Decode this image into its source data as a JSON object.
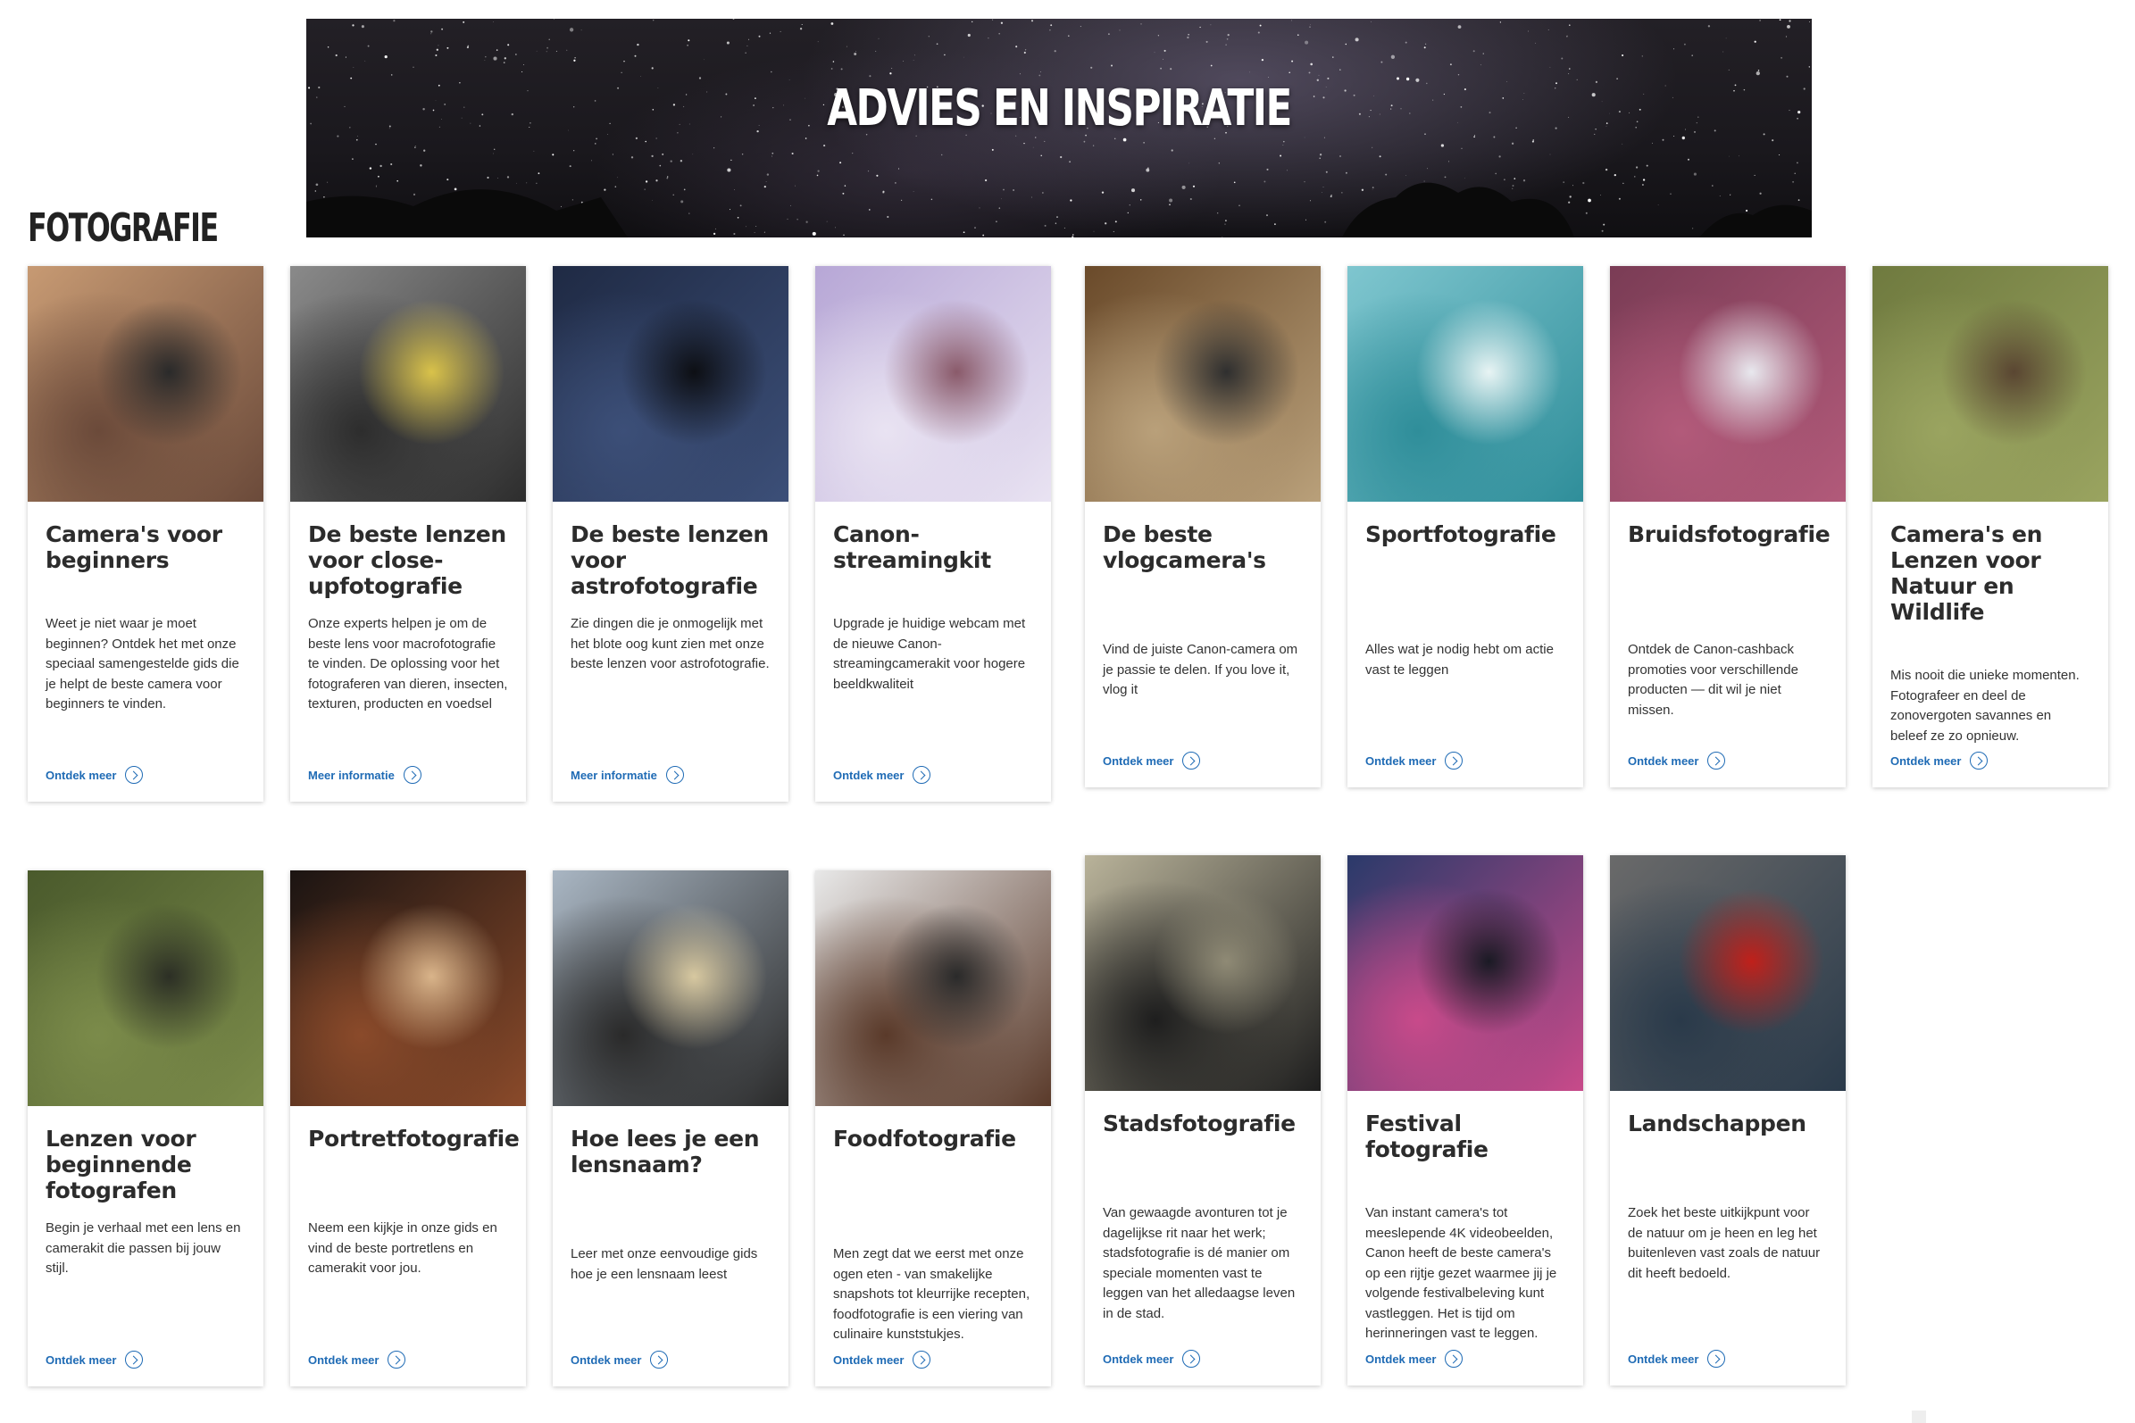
{
  "hero": {
    "title": "ADVIES EN INSPIRATIE"
  },
  "section": {
    "title": "FOTOGRAFIE"
  },
  "cards": [
    {
      "title": "Camera's voor beginners",
      "text": "Weet je niet waar je moet beginnen? Ontdek het met onze speciaal samengestelde gids die je helpt de beste camera voor beginners te vinden.",
      "link": "Ontdek meer",
      "image": "woman-photographer-holding-camera",
      "colors": [
        "#c79a73",
        "#6b4a3a",
        "#2a2a2a"
      ]
    },
    {
      "title": "De beste lenzen voor close-upfotografie",
      "text": "Onze experts helpen je om de beste lens voor macrofotografie te vinden. De oplossing voor het fotograferen van dieren, insecten, texturen, producten en voedsel",
      "link": "Meer informatie",
      "image": "owl-eye-close-up",
      "colors": [
        "#8a8a8a",
        "#2d2d2d",
        "#d9c24a"
      ]
    },
    {
      "title": "De beste lenzen voor astrofotografie",
      "text": "Zie dingen die je onmogelijk met het blote oog kunt zien met onze beste lenzen voor astrofotografie.",
      "link": "Meer informatie",
      "image": "milky-way-night-sky",
      "colors": [
        "#1f2a44",
        "#3c4f78",
        "#0d0f14"
      ]
    },
    {
      "title": "Canon-streamingkit",
      "text": "Upgrade je huidige webcam met de nieuwe Canon-streamingcamerakit voor hogere beeldkwaliteit",
      "link": "Ontdek meer",
      "image": "streamer-desk-setup",
      "colors": [
        "#b7a7d6",
        "#e9e3f2",
        "#8a5a6a"
      ]
    },
    {
      "title": "De beste vlogcamera's",
      "text": "Vind de juiste Canon-camera om je passie te delen. If you love it, vlog it",
      "link": "Ontdek meer",
      "image": "vlog-camera-on-tripod",
      "colors": [
        "#6a4a2a",
        "#b9a07a",
        "#2f2f2f"
      ]
    },
    {
      "title": "Sportfotografie",
      "text": "Alles wat je nodig hebt om actie vast te leggen",
      "link": "Ontdek meer",
      "image": "surfer-in-wave",
      "colors": [
        "#7fc6cf",
        "#2f8e9a",
        "#e8f4f4"
      ]
    },
    {
      "title": "Bruidsfotografie",
      "text": "Ontdek de Canon-cashback promoties voor verschillende producten — dit wil je niet missen.",
      "link": "Ontdek meer",
      "image": "bride-in-white-dress",
      "colors": [
        "#7a3c55",
        "#b25a7a",
        "#e8e8ee"
      ]
    },
    {
      "title": "Camera's en Lenzen voor Natuur en Wildlife",
      "text": "Mis nooit die unieke momenten. Fotografeer en deel de zonovergoten savannes en beleef ze zo opnieuw.",
      "link": "Ontdek meer",
      "image": "wildlife-photographer-on-log",
      "colors": [
        "#6f7a3f",
        "#9aa460",
        "#5a4632"
      ]
    },
    {
      "title": "Lenzen voor beginnende fotografen",
      "text": "Begin je verhaal met een lens en camerakit die passen bij jouw stijl.",
      "link": "Ontdek meer",
      "image": "man-shooting-in-forest",
      "colors": [
        "#4a5a2c",
        "#7b8b4a",
        "#2c2f25"
      ]
    },
    {
      "title": "Portretfotografie",
      "text": "Neem een kijkje in onze gids en vind de beste portretlens en camerakit voor jou.",
      "link": "Ontdek meer",
      "image": "woman-with-tea-cup",
      "colors": [
        "#1b1412",
        "#8a4a2a",
        "#d9b48a"
      ]
    },
    {
      "title": "Hoe lees je een lensnaam?",
      "text": "Leer met onze eenvoudige gids hoe je een lensnaam leest",
      "link": "Ontdek meer",
      "image": "lens-held-on-street",
      "colors": [
        "#a9b6c3",
        "#2a2a2a",
        "#d7c8a0"
      ]
    },
    {
      "title": "Foodfotografie",
      "text": "Men zegt dat we eerst met onze ogen eten - van smakelijke snapshots tot kleurrijke recepten, foodfotografie is een viering van culinaire kunststukjes.",
      "link": "Ontdek meer",
      "image": "man-photographing-dessert",
      "colors": [
        "#e8e8e8",
        "#5a3a2a",
        "#2a2a2a"
      ]
    },
    {
      "title": "Stadsfotografie",
      "text": "Van gewaagde avonturen tot je dagelijkse rit naar het werk; stadsfotografie is dé manier om speciale momenten vast te leggen van het alledaagse leven in de stad.",
      "link": "Ontdek meer",
      "image": "skateboarder-shadow",
      "colors": [
        "#b9b39a",
        "#1e1e1e",
        "#8f8a75"
      ]
    },
    {
      "title": "Festival fotografie",
      "text": "Van instant camera's tot meeslepende 4K videobeelden, Canon heeft de beste camera's op een rijtje gezet waarmee jij je volgende festivalbeleving kunt vastleggen. Het is tijd om herinneringen vast te leggen.",
      "link": "Ontdek meer",
      "image": "singer-with-guitar",
      "colors": [
        "#2a3a6a",
        "#c84a8a",
        "#1a1a24"
      ]
    },
    {
      "title": "Landschappen",
      "text": "Zoek het beste uitkijkpunt voor de natuur om je heen en leg het buitenleven vast zoals de natuur dit heeft bedoeld.",
      "link": "Ontdek meer",
      "image": "climber-on-cliff",
      "colors": [
        "#6a6a6a",
        "#2a3a4a",
        "#c0201a"
      ]
    }
  ]
}
